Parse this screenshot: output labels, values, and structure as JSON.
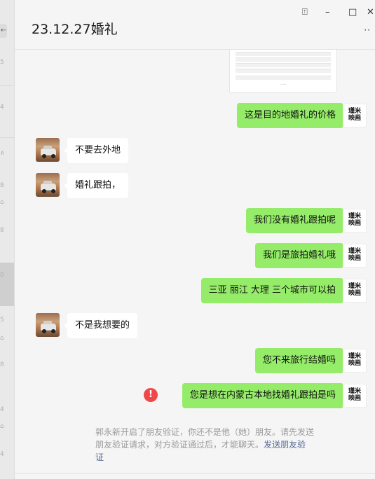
{
  "window": {
    "title": "23.12.27婚礼",
    "pin_glyph": "⍐",
    "minimize_glyph": "–",
    "maximize_glyph": "□",
    "close_glyph": "✕",
    "more_glyph": "··"
  },
  "left_strip": {
    "collapse_glyph": "←",
    "marks": [
      "5",
      "4",
      "∧",
      "8",
      "⌂",
      "8",
      "0",
      "5",
      "⌂",
      "8",
      "4",
      "⌂",
      "4"
    ]
  },
  "doc_preview": {
    "caption": "·····"
  },
  "me_avatar": {
    "line1": "瑾米",
    "line2": "映画",
    "line3": "· · · ·"
  },
  "messages": [
    {
      "from": "me",
      "text": "这是目的地婚礼的价格"
    },
    {
      "from": "other",
      "text": "不要去外地"
    },
    {
      "from": "other",
      "text": "婚礼跟拍，"
    },
    {
      "from": "me",
      "text": "我们没有婚礼跟拍呢"
    },
    {
      "from": "me",
      "text": "我们是旅拍婚礼哦"
    },
    {
      "from": "me",
      "text": "三亚 丽江 大理 三个城市可以拍"
    },
    {
      "from": "other",
      "text": "不是我想要的"
    },
    {
      "from": "me",
      "text": "您不来旅行结婚吗"
    },
    {
      "from": "me",
      "text": "您是想在内蒙古本地找婚礼跟拍是吗",
      "failed": true
    }
  ],
  "error_glyph": "!",
  "system_notice": {
    "text": "郭永新开启了朋友验证，你还不是他（她）朋友。请先发送朋友验证请求，对方验证通过后，才能聊天。",
    "link": "发送朋友验证"
  },
  "colors": {
    "me_bubble": "#95ec69",
    "other_bubble": "#ffffff",
    "background": "#f5f5f5",
    "link": "#576b95",
    "error": "#f04848"
  }
}
